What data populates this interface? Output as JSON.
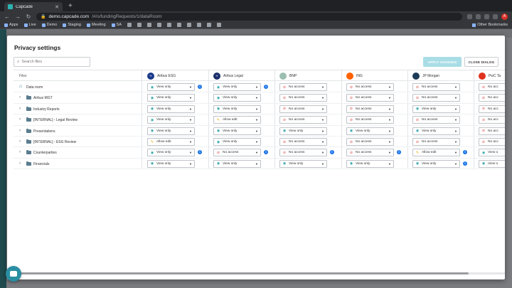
{
  "browser": {
    "tab_title": "Capcade",
    "url_host": "demo.capcade.com",
    "url_path": "/#/s/fundingRequests/1/dataRoom",
    "profile_initial": "A",
    "bookmarks": [
      "Apps",
      "Live",
      "Demo",
      "Staging",
      "Meeting",
      "SA"
    ],
    "other_bookmarks": "Other Bookmarks"
  },
  "dialog": {
    "title": "Privacy settings",
    "search_placeholder": "Search files",
    "apply_label": "APPLY CHANGES",
    "close_label": "CLOSE DIALOG",
    "files_header": "Files"
  },
  "columns": [
    {
      "name": "Airbus ESG",
      "logo_color": "#1b3a8a"
    },
    {
      "name": "Airbus Legal",
      "logo_color": "#1b2f6b"
    },
    {
      "name": "BNP",
      "logo_color": "#9bbfb0"
    },
    {
      "name": "ING",
      "logo_color": "#ff6200"
    },
    {
      "name": "JP Morgan",
      "logo_color": "#1d3b57"
    },
    {
      "name": "PwC Ta",
      "logo_color": "#e0301e"
    }
  ],
  "rows": [
    {
      "name": "Data room",
      "type": "root",
      "cells": [
        "View only",
        "View only",
        "No access",
        "No access",
        "No access",
        "No acc"
      ],
      "info": [
        true,
        true,
        false,
        false,
        false,
        false
      ]
    },
    {
      "name": "Airbus MGT",
      "type": "folder",
      "cells": [
        "View only",
        "View only",
        "No access",
        "No access",
        "No access",
        "No acc"
      ],
      "info": [
        false,
        false,
        false,
        false,
        false,
        false
      ]
    },
    {
      "name": "Industry Reports",
      "type": "folder",
      "cells": [
        "View only",
        "View only",
        "No access",
        "No access",
        "View only",
        "No acc"
      ],
      "info": [
        false,
        false,
        false,
        false,
        false,
        false
      ]
    },
    {
      "name": "[INTERNAL] - Legal Review",
      "type": "folder",
      "cells": [
        "View only",
        "Allow edit",
        "No access",
        "No access",
        "No access",
        "No acc"
      ],
      "info": [
        false,
        false,
        false,
        false,
        false,
        false
      ]
    },
    {
      "name": "Presentations",
      "type": "folder",
      "cells": [
        "View only",
        "View only",
        "View only",
        "View only",
        "View only",
        "No acc"
      ],
      "info": [
        false,
        false,
        false,
        false,
        false,
        false
      ]
    },
    {
      "name": "[INTERNAL] - ESG Review",
      "type": "folder",
      "cells": [
        "Allow edit",
        "View only",
        "No access",
        "No access",
        "No access",
        "No acc"
      ],
      "info": [
        false,
        false,
        false,
        false,
        false,
        false
      ]
    },
    {
      "name": "Counterparties",
      "type": "folder",
      "cells": [
        "View only",
        "No access",
        "No access",
        "No access",
        "Allow edit",
        "View o"
      ],
      "info": [
        true,
        true,
        true,
        true,
        true,
        false
      ]
    },
    {
      "name": "Financials",
      "type": "folder",
      "cells": [
        "View only",
        "View only",
        "View only",
        "View only",
        "View only",
        "View o"
      ],
      "info": [
        false,
        false,
        false,
        false,
        true,
        false
      ]
    }
  ]
}
